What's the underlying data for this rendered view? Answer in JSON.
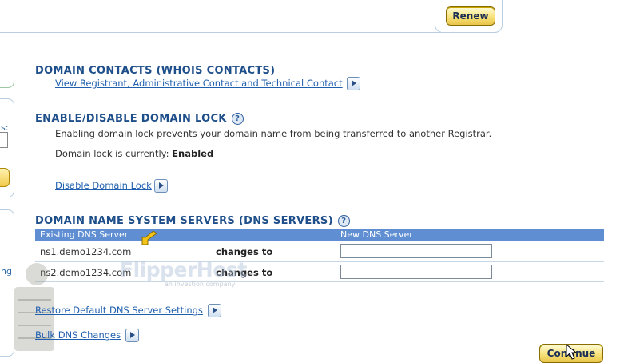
{
  "renew": {
    "label": "Renew"
  },
  "contacts": {
    "title": "DOMAIN CONTACTS (WHOIS CONTACTS)",
    "link": "View Registrant, Administrative Contact and Technical Contact"
  },
  "lock": {
    "title": "ENABLE/DISABLE DOMAIN LOCK",
    "help": "?",
    "description": "Enabling domain lock prevents your domain name from being transferred to another Registrar.",
    "status_label": "Domain lock is currently:",
    "status_value": "Enabled",
    "link": "Disable Domain Lock"
  },
  "dns": {
    "title": "DOMAIN NAME SYSTEM SERVERS (DNS SERVERS)",
    "help": "?",
    "col_existing": "Existing DNS Server",
    "col_new": "New DNS Server",
    "rows": [
      {
        "existing": "ns1.demo1234.com",
        "changes": "changes to",
        "new_value": ""
      },
      {
        "existing": "ns2.demo1234.com",
        "changes": "changes to",
        "new_value": ""
      }
    ],
    "restore_link": "Restore Default DNS Server Settings",
    "bulk_link": "Bulk DNS Changes"
  },
  "continue": {
    "label": "Continue"
  },
  "watermark": {
    "brand": "FlipperHost",
    "tagline": "an investion company"
  },
  "sidebar": {
    "fragment_1": "ng",
    "fragment_2": "s:"
  },
  "colors": {
    "heading": "#1e4f8a",
    "link": "#1f5fae",
    "table_header": "#5f8ed2",
    "button_gold": "#f7e27a"
  }
}
